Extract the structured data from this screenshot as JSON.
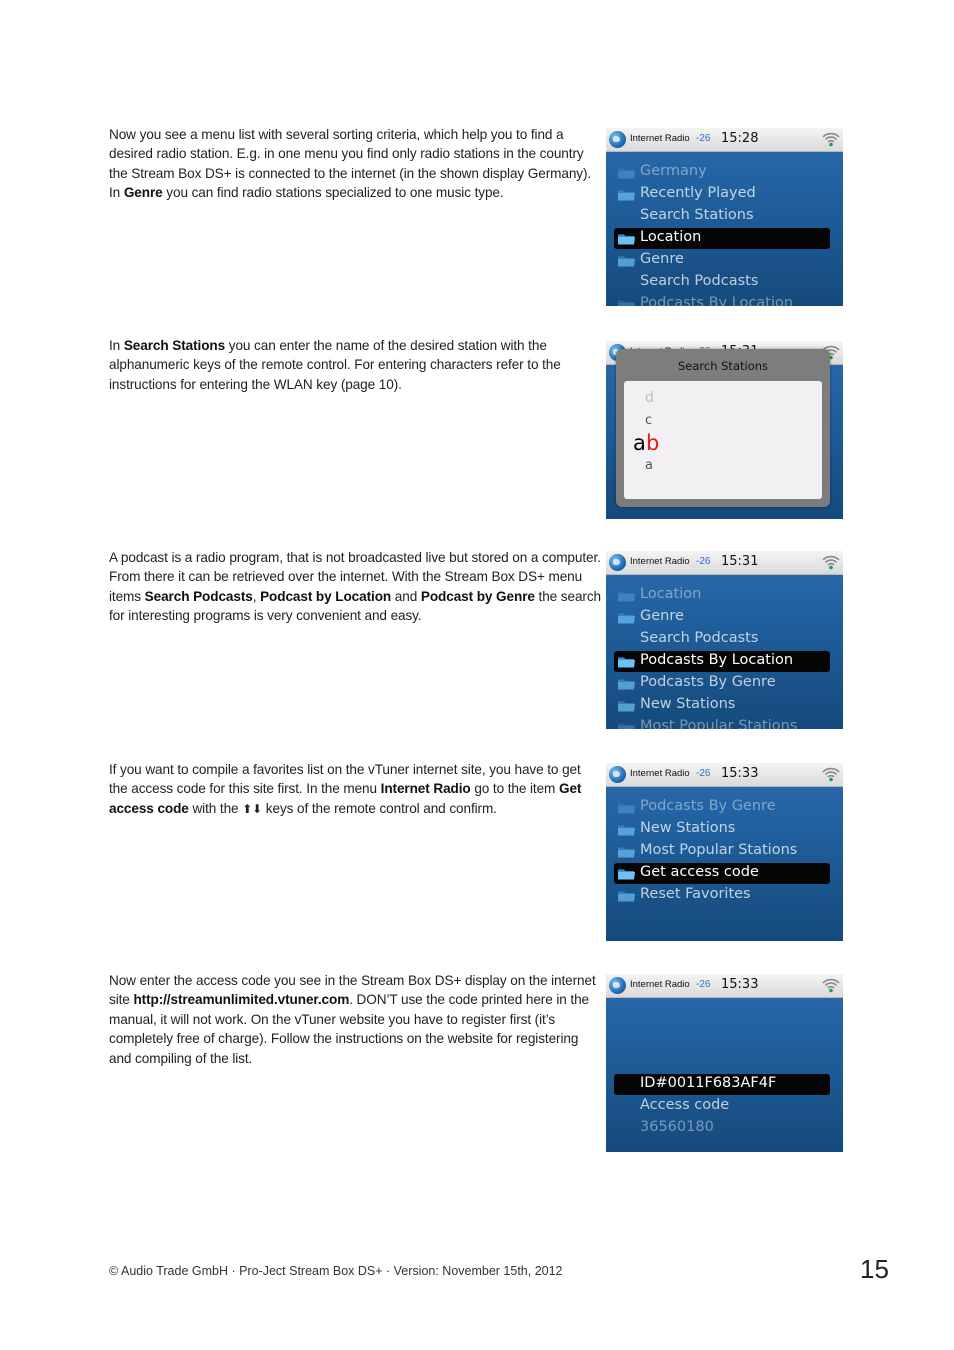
{
  "sections": [
    {
      "paragraph": [
        {
          "t": "Now you see a menu list with several sorting criteria, which help you to find a desired radio station. E.g. in one menu you find only radio stations in the country the Stream Box DS+ is connected to the internet (in the shown display Germany). In "
        },
        {
          "t": "Genre",
          "b": true
        },
        {
          "t": " you can find radio stations specialized to one music type."
        }
      ],
      "screen": {
        "title": "Internet Radio",
        "signal": "-26",
        "time": "15:28",
        "items": [
          {
            "label": "Germany",
            "folder": true,
            "state": "dim1"
          },
          {
            "label": "Recently Played",
            "folder": true,
            "state": "dim2"
          },
          {
            "label": "Search Stations",
            "folder": false,
            "state": "dim2"
          },
          {
            "label": "Location",
            "folder": true,
            "state": "sel"
          },
          {
            "label": "Genre",
            "folder": true,
            "state": "dim2"
          },
          {
            "label": "Search Podcasts",
            "folder": false,
            "state": "dim2"
          },
          {
            "label": "Podcasts By Location",
            "folder": true,
            "state": "dim1"
          }
        ]
      }
    },
    {
      "paragraph": [
        {
          "t": "In  "
        },
        {
          "t": "Search Stations",
          "b": true
        },
        {
          "t": " you can enter the name of the desired station with the alphanumeric keys of the remote control. For entering characters refer to the instructions for entering the WLAN key (page 10)."
        }
      ],
      "dialog": {
        "title": "Search Stations",
        "char_above2": "d",
        "char_above1": "c",
        "typed": "a",
        "current": "b",
        "char_below1": "a"
      }
    },
    {
      "paragraph": [
        {
          "t": "A podcast is a radio program, that is not broadcasted live but stored on a computer. From there it can be retrieved over the internet. With the Stream Box DS+ menu items "
        },
        {
          "t": "Search Podcasts",
          "b": true
        },
        {
          "t": ", "
        },
        {
          "t": "Podcast by Location",
          "b": true
        },
        {
          "t": " and "
        },
        {
          "t": "Podcast by Genre",
          "b": true
        },
        {
          "t": " the search for interesting programs is very convenient and easy."
        }
      ],
      "screen": {
        "title": "Internet Radio",
        "signal": "-26",
        "time": "15:31",
        "items": [
          {
            "label": "Location",
            "folder": true,
            "state": "dim1"
          },
          {
            "label": "Genre",
            "folder": true,
            "state": "dim2"
          },
          {
            "label": "Search Podcasts",
            "folder": false,
            "state": "dim2"
          },
          {
            "label": "Podcasts By Location",
            "folder": true,
            "state": "sel"
          },
          {
            "label": "Podcasts By Genre",
            "folder": true,
            "state": "dim2"
          },
          {
            "label": "New Stations",
            "folder": true,
            "state": "dim2"
          },
          {
            "label": "Most Popular Stations",
            "folder": true,
            "state": "dim1"
          }
        ]
      }
    },
    {
      "paragraph": [
        {
          "t": "If you want to compile a favorites list on the vTuner internet site, you have to get the access code for this site first. In the menu "
        },
        {
          "t": "Internet Radio",
          "b": true
        },
        {
          "t": " go to the item "
        },
        {
          "t": "Get access code",
          "b": true
        },
        {
          "t": " with the "
        },
        {
          "t": "⬆⬇",
          "arrows": true
        },
        {
          "t": " keys of the remote control and confirm."
        }
      ],
      "screen": {
        "title": "Internet Radio",
        "signal": "-26",
        "time": "15:33",
        "items": [
          {
            "label": "Podcasts By Genre",
            "folder": true,
            "state": "dim1"
          },
          {
            "label": "New Stations",
            "folder": true,
            "state": "dim2"
          },
          {
            "label": "Most Popular Stations",
            "folder": true,
            "state": "dim2"
          },
          {
            "label": "Get access code",
            "folder": true,
            "state": "sel"
          },
          {
            "label": "Reset Favorites",
            "folder": true,
            "state": "dim2"
          }
        ]
      }
    },
    {
      "paragraph": [
        {
          "t": "Now enter the access code you see in the Stream Box DS+ display on the internet site "
        },
        {
          "t": "http://streamunlimited.vtuner.com",
          "b": true
        },
        {
          "t": ". DON’T use the code printed here in the manual, it will not work. On the vTuner website you have to register first (it’s completely free of charge). Follow the instructions on the website for registering and compiling of the list."
        }
      ],
      "screen": {
        "title": "Internet Radio",
        "signal": "-26",
        "time": "15:33",
        "items": [
          {
            "label": "",
            "folder": false,
            "state": "blank"
          },
          {
            "label": "",
            "folder": false,
            "state": "blank"
          },
          {
            "label": "",
            "folder": false,
            "state": "blank"
          },
          {
            "label": "ID#0011F683AF4F",
            "folder": false,
            "state": "sel"
          },
          {
            "label": "Access code",
            "folder": false,
            "state": "dim2"
          },
          {
            "label": "36560180",
            "folder": false,
            "state": "dim1"
          }
        ]
      }
    }
  ],
  "footer": {
    "text": "© Audio Trade GmbH · Pro-Ject Stream Box DS+ · Version: November 15th, 2012",
    "page_number": "15"
  }
}
